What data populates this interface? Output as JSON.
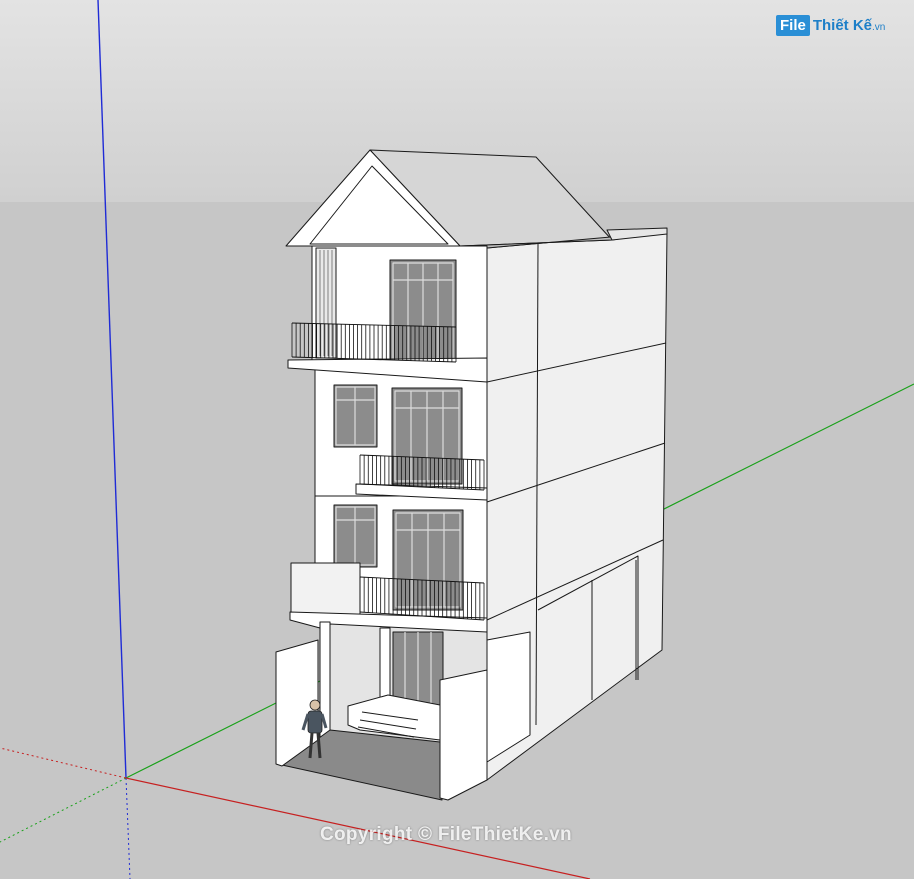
{
  "watermark": {
    "logo_box": "File",
    "logo_text": "Thiết Kế",
    "logo_suffix": ".vn",
    "copyright": "Copyright © FileThietKe.vn"
  },
  "colors": {
    "sky_top": "#e1e1e1",
    "sky_bottom": "#cfcfcf",
    "ground": "#c6c6c6",
    "axis_blue": "#1f2bd6",
    "axis_green": "#19a119",
    "axis_red": "#c62020",
    "wall": "#ffffff",
    "side_wall": "#f0f0f0",
    "roof": "#d4d4d4",
    "glass": "#8c8c8c",
    "floor": "#8a8a8a",
    "logo_blue": "#2a8fd6"
  }
}
